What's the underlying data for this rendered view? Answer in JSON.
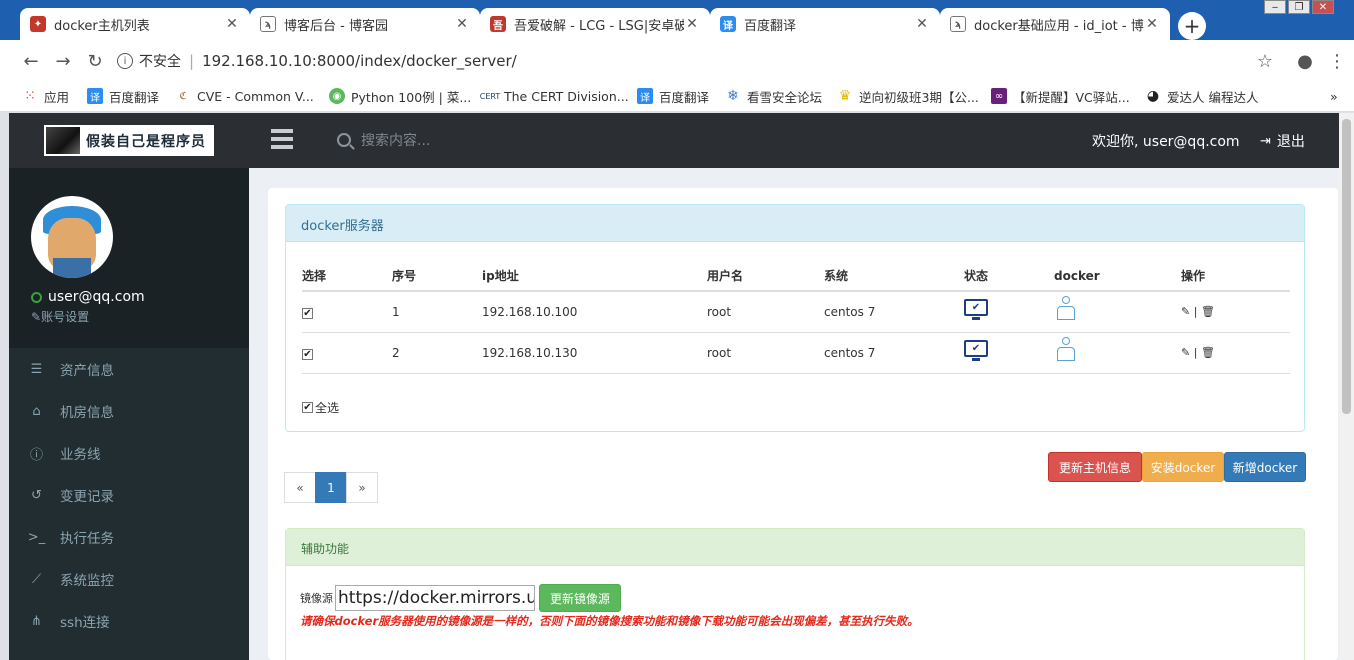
{
  "browser": {
    "tabs": [
      {
        "label": "docker主机列表",
        "favicon": "red-logo-icon",
        "color": "#c0392b"
      },
      {
        "label": "博客后台 - 博客园",
        "favicon": "cnblogs-icon",
        "color": "#555555"
      },
      {
        "label": "吾爱破解 - LCG - LSG|安卓破解",
        "favicon": "52pojie-icon",
        "color": "#c0392b"
      },
      {
        "label": "百度翻译",
        "favicon": "translate-icon",
        "color": "#2d8cf0"
      },
      {
        "label": "docker基础应用 - id_iot - 博客",
        "favicon": "cnblogs-icon",
        "color": "#555555"
      }
    ],
    "tab_close": "✕",
    "newtab": "+",
    "omnibox": {
      "insecure_label": "不安全",
      "url": "192.168.10.10:8000/index/docker_server/"
    },
    "bookmarks": [
      {
        "label": "应用",
        "icon": "apps-grid-icon",
        "color": "#e84c3d"
      },
      {
        "label": "百度翻译",
        "icon": "translate-icon",
        "color": "#2d8cf0"
      },
      {
        "label": "CVE - Common V...",
        "icon": "cve-icon",
        "color": "#8e6a2e"
      },
      {
        "label": "Python 100例 | 菜...",
        "icon": "runoob-icon",
        "color": "#5cb85c"
      },
      {
        "label": "The CERT Division...",
        "icon": "cert-icon",
        "color": "#1f3c6e"
      },
      {
        "label": "百度翻译",
        "icon": "translate-icon",
        "color": "#2d8cf0"
      },
      {
        "label": "看雪安全论坛",
        "icon": "snowflake-icon",
        "color": "#3b7dd8"
      },
      {
        "label": "逆向初级班3期【公...",
        "icon": "trophy-icon",
        "color": "#e6b800"
      },
      {
        "label": "【新提醒】VC驿站...",
        "icon": "vs-icon",
        "color": "#68217a"
      },
      {
        "label": "爱达人 编程达人",
        "icon": "github-icon",
        "color": "#222222"
      }
    ],
    "more": "»"
  },
  "app": {
    "logo_text": "假装自己是程序员",
    "search_placeholder": "搜索内容...",
    "welcome": "欢迎你, user@qq.com",
    "logout": "退出",
    "user": {
      "name": "user@qq.com",
      "account_settings": "账号设置"
    },
    "nav": [
      {
        "label": "资产信息",
        "icon": "server-icon",
        "glyph": "☰"
      },
      {
        "label": "机房信息",
        "icon": "home-icon",
        "glyph": "⌂"
      },
      {
        "label": "业务线",
        "icon": "info-icon",
        "glyph": "ⓘ"
      },
      {
        "label": "变更记录",
        "icon": "history-icon",
        "glyph": "↺"
      },
      {
        "label": "执行任务",
        "icon": "terminal-icon",
        "glyph": ">_"
      },
      {
        "label": "系统监控",
        "icon": "line-chart-icon",
        "glyph": "⟋"
      },
      {
        "label": "ssh连接",
        "icon": "sitemap-icon",
        "glyph": "⋔"
      }
    ],
    "servers_panel": {
      "title": "docker服务器",
      "columns": [
        "选择",
        "序号",
        "ip地址",
        "用户名",
        "系统",
        "状态",
        "docker",
        "操作"
      ],
      "rows": [
        {
          "checked": true,
          "index": "1",
          "ip": "192.168.10.100",
          "user": "root",
          "os": "centos 7"
        },
        {
          "checked": true,
          "index": "2",
          "ip": "192.168.10.130",
          "user": "root",
          "os": "centos 7"
        }
      ],
      "ops_sep": "|",
      "select_all": "全选"
    },
    "buttons": {
      "update_host": "更新主机信息",
      "install_docker": "安装docker",
      "add_docker": "新增docker"
    },
    "pagination": {
      "prev": "«",
      "current": "1",
      "next": "»"
    },
    "aux_panel": {
      "title": "辅助功能",
      "mirror_label": "镜像源",
      "mirror_value": "https://docker.mirrors.ustc.edu.cn",
      "update_mirror": "更新镜像源",
      "warning": "请确保docker服务器使用的镜像源是一样的，否则下面的镜像搜索功能和镜像下载功能可能会出现偏差，甚至执行失败。"
    }
  }
}
